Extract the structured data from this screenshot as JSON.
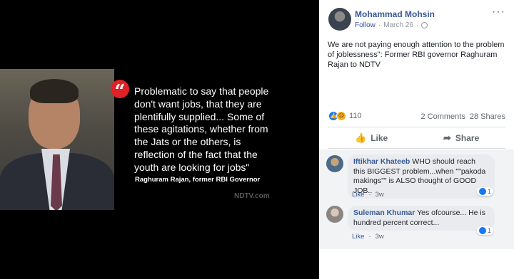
{
  "media": {
    "quote": "Problematic to say that people don't want jobs, that they are plentifully supplied... Some of these agitations, whether from the Jats or the others, is reflection of the fact that the youth are looking for jobs\"",
    "source": "Raghuram Rajan, former RBI Governor",
    "watermark": "NDTV.com",
    "quote_mark": "“",
    "accent": "#e02127"
  },
  "post": {
    "author": "Mohammad Mohsin",
    "follow": "Follow",
    "separator": "·",
    "date": "March 26",
    "separator2": "·",
    "more": "···",
    "text": "We are not paying enough attention to the problem of joblessness\": Former RBI governor Raghuram Rajan to NDTV",
    "reaction_count": "110",
    "comments_count": "2 Comments",
    "shares_count": "28 Shares",
    "like_label": "Like",
    "share_label": "Share",
    "brand_color": "#385898"
  },
  "comments": [
    {
      "name": "Iftikhar Khateeb",
      "text": "WHO should reach this BIGGEST problem...when \"\"pakoda makings\"\" is ALSO thought of GOOD JOB..",
      "reactions": "1",
      "like": "Like",
      "dot": "·",
      "time": "3w"
    },
    {
      "name": "Suleman Khumar",
      "text": "Yes ofcourse... He is hundred percent correct...",
      "reactions": "1",
      "like": "Like",
      "dot": "·",
      "time": "3w"
    }
  ]
}
